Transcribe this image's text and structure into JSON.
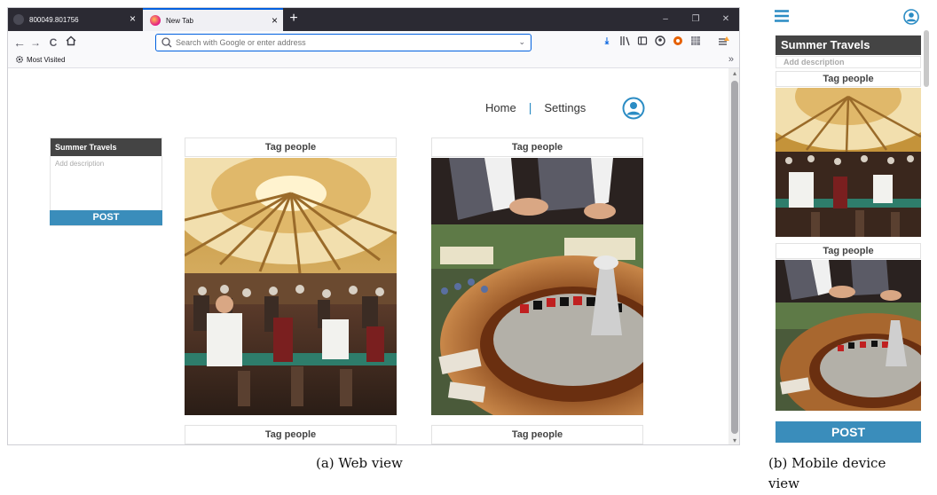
{
  "browser": {
    "tabs": [
      {
        "label": "800049.801756",
        "active": false
      },
      {
        "label": "New Tab",
        "active": true
      }
    ],
    "new_tab": "+",
    "address_placeholder": "Search with Google or enter address",
    "bookmarks": {
      "most_visited": "Most Visited",
      "overflow": "»"
    },
    "window_controls": [
      "–",
      "❐",
      "✕"
    ],
    "accent_color": "#0060df"
  },
  "site": {
    "nav": {
      "home": "Home",
      "separator": "|",
      "settings": "Settings"
    },
    "compose": {
      "title": "Summer Travels",
      "description_placeholder": "Add description",
      "post_label": "POST"
    },
    "cards": [
      {
        "tag_top": "Tag people",
        "tag_bottom": "Tag people",
        "image": "casino-hall-chandelier"
      },
      {
        "tag_top": "Tag people",
        "tag_bottom": "Tag people",
        "image": "roulette-wheel"
      }
    ],
    "post_button_color": "#3a8dbb"
  },
  "mobile": {
    "title": "Summer Travels",
    "description_placeholder": "Add description",
    "tags": [
      "Tag people",
      "Tag people"
    ],
    "post_label": "POST"
  },
  "captions": {
    "web": "(a) Web view",
    "mobile_line1": "(b)  Mobile device",
    "mobile_line2": "view"
  }
}
